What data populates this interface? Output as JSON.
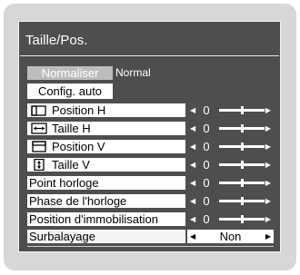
{
  "menu": {
    "title": "Taille/Pos.",
    "normalize_button": "Normaliser",
    "normalize_status": "Normal",
    "auto_config_button": "Config. auto",
    "rows": [
      {
        "label": "Position H",
        "icon": "h-position-icon",
        "value": "0",
        "slider_level": 0.5
      },
      {
        "label": "Taille H",
        "icon": "h-size-icon",
        "value": "0",
        "slider_level": 0.5
      },
      {
        "label": "Position V",
        "icon": "v-position-icon",
        "value": "0",
        "slider_level": 0.5
      },
      {
        "label": "Taille V",
        "icon": "v-size-icon",
        "value": "0",
        "slider_level": 0.5
      },
      {
        "label": "Point horloge",
        "value": "0",
        "slider_level": 0.5
      },
      {
        "label": "Phase de l'horloge",
        "value": "0",
        "slider_level": 0.5
      },
      {
        "label": "Position d'immobilisation",
        "value": "0",
        "slider_level": 0.5
      },
      {
        "label": "Surbalayage",
        "value": "Non"
      }
    ]
  },
  "colors": {
    "osd_background": "#4e4e4e",
    "bezel": "#d7d7d9",
    "normalize_button": "#bdbdbd"
  }
}
